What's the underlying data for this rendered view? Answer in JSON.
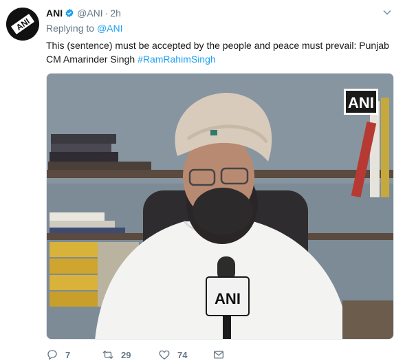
{
  "tweet": {
    "author_name": "ANI",
    "handle": "@ANI",
    "separator": "·",
    "time": "2h",
    "replying_prefix": "Replying to",
    "replying_to": "@ANI",
    "text_line1": "This (sentence) must be accepted by the people and peace must prevail: Punjab",
    "text_line2_plain": "CM Amarinder Singh ",
    "hashtag": "#RamRahimSingh",
    "media_watermark": "ANI",
    "mic_label": "ANI"
  },
  "actions": {
    "reply_count": "7",
    "retweet_count": "29",
    "like_count": "74"
  },
  "icons": {
    "avatar": "ani-logo-avatar",
    "verified": "verified-badge-icon",
    "caret": "chevron-down-icon",
    "reply": "reply-icon",
    "retweet": "retweet-icon",
    "like": "heart-icon",
    "dm": "envelope-icon"
  },
  "colors": {
    "link": "#1da1f2",
    "muted": "#657786",
    "text": "#14171a"
  }
}
